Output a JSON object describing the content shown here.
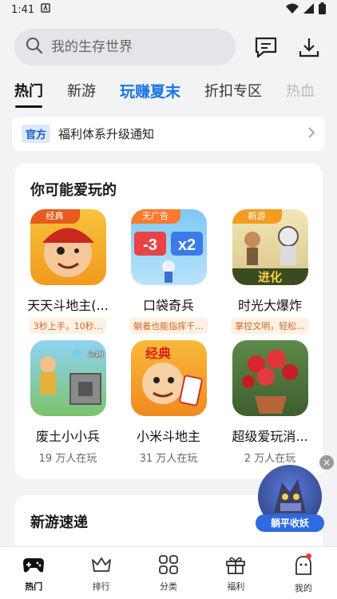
{
  "status": {
    "time": "1:41"
  },
  "search": {
    "placeholder": "我的生存世界"
  },
  "tabs": [
    {
      "label": "热门"
    },
    {
      "label": "新游"
    },
    {
      "label": "玩赚夏末"
    },
    {
      "label": "折扣专区"
    },
    {
      "label": "热血"
    }
  ],
  "notice": {
    "tag": "官方",
    "text": "福利体系升级通知"
  },
  "recommend": {
    "title": "你可能爱玩的",
    "games": [
      {
        "name": "天天斗地主(...",
        "badge": "经典",
        "chip": "3秒上手，10秒..."
      },
      {
        "name": "口袋奇兵",
        "badge": "无广告",
        "chip": "躺着也能指挥千..."
      },
      {
        "name": "时光大爆炸",
        "badge": "新游",
        "chip": "掌控文明，轻松..."
      },
      {
        "name": "废土小小兵",
        "players": "19 万人在玩"
      },
      {
        "name": "小米斗地主",
        "players": "31 万人在玩"
      },
      {
        "name": "超级爱玩消...",
        "players": "2 万人在玩"
      }
    ],
    "icon_texts": {
      "g2_left": "-3",
      "g2_right": "x2",
      "g3_banner": "进化",
      "g4_num": "640",
      "g5_banner": "经典"
    }
  },
  "newgames": {
    "title": "新游速递"
  },
  "float": {
    "label": "躺平收妖",
    "close": "×"
  },
  "nav": [
    {
      "label": "热门"
    },
    {
      "label": "排行"
    },
    {
      "label": "分类"
    },
    {
      "label": "福利"
    },
    {
      "label": "我的"
    }
  ],
  "colors": {
    "accent": "#1a73e8",
    "chip_text": "#d2691e",
    "notify_dot": "#ee3b3b"
  }
}
